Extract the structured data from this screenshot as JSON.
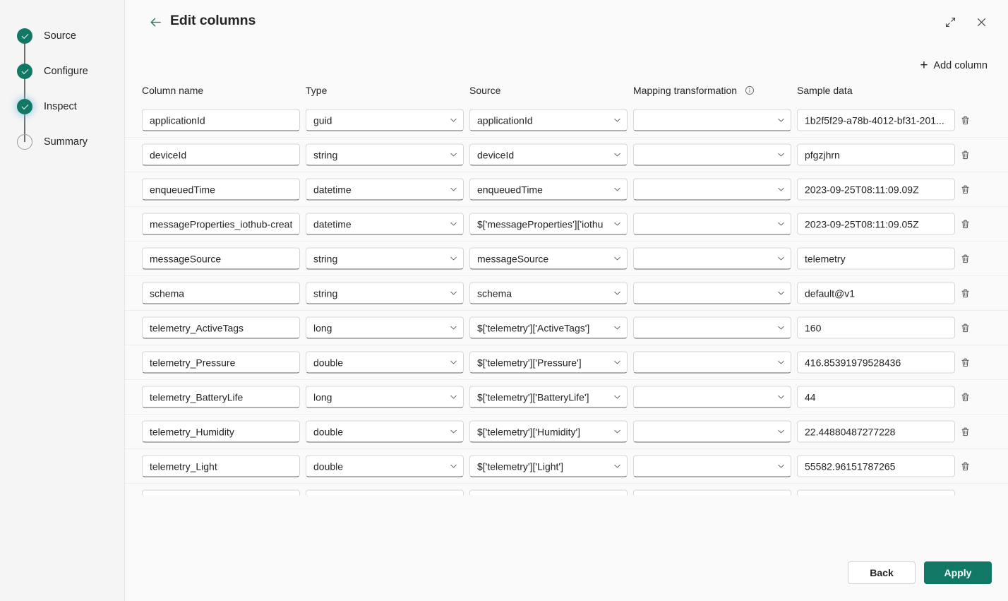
{
  "wizard": {
    "steps": [
      {
        "label": "Source",
        "state": "done"
      },
      {
        "label": "Configure",
        "state": "done"
      },
      {
        "label": "Inspect",
        "state": "current"
      },
      {
        "label": "Summary",
        "state": "todo"
      }
    ]
  },
  "header": {
    "title": "Edit columns",
    "back_icon": "arrow-left-icon",
    "expand_icon": "expand-diagonal-icon",
    "close_icon": "close-icon"
  },
  "toolbar": {
    "add_column_label": "Add column",
    "add_column_icon": "plus-icon"
  },
  "table": {
    "headers": {
      "column_name": "Column name",
      "type": "Type",
      "source": "Source",
      "mapping_transformation": "Mapping transformation",
      "mapping_info_icon": "info-icon",
      "sample_data": "Sample data"
    },
    "delete_icon": "trash-icon",
    "chevron_icon": "chevron-down-icon",
    "rows": [
      {
        "name": "applicationId",
        "type": "guid",
        "source": "applicationId",
        "mapping": "",
        "sample": "1b2f5f29-a78b-4012-bf31-201..."
      },
      {
        "name": "deviceId",
        "type": "string",
        "source": "deviceId",
        "mapping": "",
        "sample": "pfgzjhrn"
      },
      {
        "name": "enqueuedTime",
        "type": "datetime",
        "source": "enqueuedTime",
        "mapping": "",
        "sample": "2023-09-25T08:11:09.09Z"
      },
      {
        "name": "messageProperties_iothub-creat",
        "type": "datetime",
        "source": "$['messageProperties']['iothu",
        "mapping": "",
        "sample": "2023-09-25T08:11:09.05Z"
      },
      {
        "name": "messageSource",
        "type": "string",
        "source": "messageSource",
        "mapping": "",
        "sample": "telemetry"
      },
      {
        "name": "schema",
        "type": "string",
        "source": "schema",
        "mapping": "",
        "sample": "default@v1"
      },
      {
        "name": "telemetry_ActiveTags",
        "type": "long",
        "source": "$['telemetry']['ActiveTags']",
        "mapping": "",
        "sample": "160"
      },
      {
        "name": "telemetry_Pressure",
        "type": "double",
        "source": "$['telemetry']['Pressure']",
        "mapping": "",
        "sample": "416.85391979528436"
      },
      {
        "name": "telemetry_BatteryLife",
        "type": "long",
        "source": "$['telemetry']['BatteryLife']",
        "mapping": "",
        "sample": "44"
      },
      {
        "name": "telemetry_Humidity",
        "type": "double",
        "source": "$['telemetry']['Humidity']",
        "mapping": "",
        "sample": "22.44880487277228"
      },
      {
        "name": "telemetry_Light",
        "type": "double",
        "source": "$['telemetry']['Light']",
        "mapping": "",
        "sample": "55582.96151787265"
      },
      {
        "name": "",
        "type": "",
        "source": "",
        "mapping": "",
        "sample": ""
      }
    ]
  },
  "footer": {
    "back_label": "Back",
    "apply_label": "Apply"
  },
  "colors": {
    "accent": "#117865",
    "page_bg": "#fafafa",
    "sidebar_bg": "#f5f5f5",
    "text": "#242424"
  }
}
